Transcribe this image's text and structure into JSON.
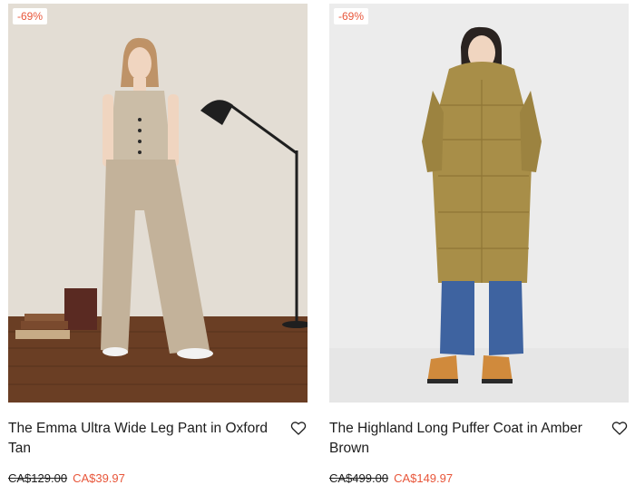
{
  "products": [
    {
      "discount_badge": "-69%",
      "title": "The Emma Ultra Wide Leg Pant in Oxford Tan",
      "original_price": "CA$129.00",
      "sale_price": "CA$39.97",
      "image_icon": "model-photo-tan-pants"
    },
    {
      "discount_badge": "-69%",
      "title": "The Highland Long Puffer Coat in Amber Brown",
      "original_price": "CA$499.00",
      "sale_price": "CA$149.97",
      "image_icon": "model-photo-puffer-coat"
    }
  ],
  "colors": {
    "sale": "#e8563a",
    "text": "#1c1c1c"
  },
  "icons": {
    "wishlist": "heart-icon"
  }
}
